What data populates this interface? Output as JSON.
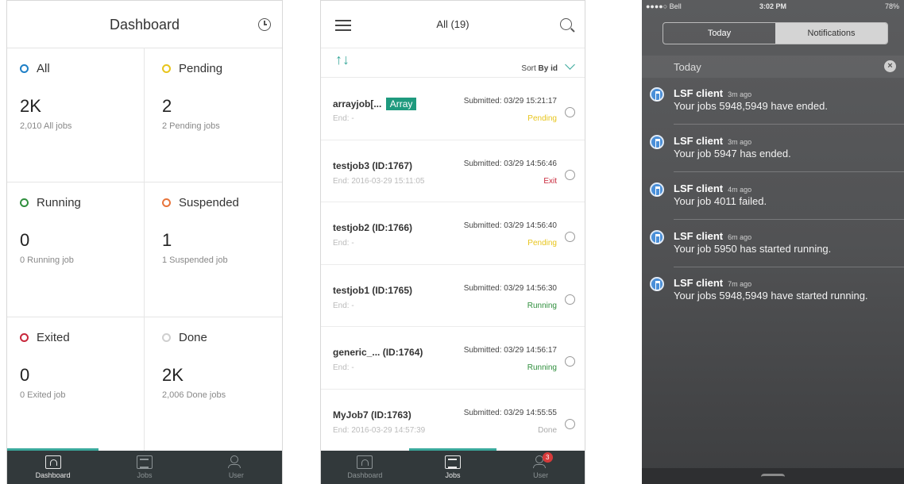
{
  "dashboard": {
    "title": "Dashboard",
    "cells": [
      {
        "label": "All",
        "big": "2K",
        "sub": "2,010 All jobs",
        "color": "#1e7fc6"
      },
      {
        "label": "Pending",
        "big": "2",
        "sub": "2 Pending jobs",
        "color": "#e8c51c"
      },
      {
        "label": "Running",
        "big": "0",
        "sub": "0 Running job",
        "color": "#2f8f3d"
      },
      {
        "label": "Suspended",
        "big": "1",
        "sub": "1 Suspended job",
        "color": "#e8743b"
      },
      {
        "label": "Exited",
        "big": "0",
        "sub": "0 Exited job",
        "color": "#c8283b"
      },
      {
        "label": "Done",
        "big": "2K",
        "sub": "2,006 Done jobs",
        "color": "#cfcfcf"
      }
    ],
    "tabs": [
      {
        "label": "Dashboard",
        "icon": "dashboard-icon"
      },
      {
        "label": "Jobs",
        "icon": "jobs-icon"
      },
      {
        "label": "User",
        "icon": "user-icon"
      }
    ]
  },
  "jobs": {
    "title": "All (19)",
    "sort_prefix": "Sort",
    "sort_key": "By id",
    "rows": [
      {
        "name": "arrayjob[...",
        "tag": "Array",
        "end": "End: -",
        "submitted": "Submitted: 03/29 15:21:17",
        "status": "Pending"
      },
      {
        "name": "testjob3 (ID:1767)",
        "tag": "",
        "end": "End: 2016-03-29 15:11:05",
        "submitted": "Submitted: 03/29 14:56:46",
        "status": "Exit"
      },
      {
        "name": "testjob2 (ID:1766)",
        "tag": "",
        "end": "End: -",
        "submitted": "Submitted: 03/29 14:56:40",
        "status": "Pending"
      },
      {
        "name": "testjob1 (ID:1765)",
        "tag": "",
        "end": "End: -",
        "submitted": "Submitted: 03/29 14:56:30",
        "status": "Running"
      },
      {
        "name": "generic_... (ID:1764)",
        "tag": "",
        "end": "End: -",
        "submitted": "Submitted: 03/29 14:56:17",
        "status": "Running"
      },
      {
        "name": "MyJob7 (ID:1763)",
        "tag": "",
        "end": "End: 2016-03-29 14:57:39",
        "submitted": "Submitted: 03/29 14:55:55",
        "status": "Done"
      }
    ],
    "status_colors": {
      "Pending": "#e8c51c",
      "Exit": "#c8283b",
      "Running": "#2f8f3d",
      "Done": "#aaaaaa"
    },
    "user_badge": "3"
  },
  "notifications": {
    "status_left": "●●●●○ Bell",
    "time": "3:02 PM",
    "battery": "78%",
    "seg_today": "Today",
    "seg_notifications": "Notifications",
    "section": "Today",
    "items": [
      {
        "app": "LSF client",
        "ago": "3m ago",
        "msg": "Your jobs 5948,5949 have ended."
      },
      {
        "app": "LSF client",
        "ago": "3m ago",
        "msg": "Your job 5947 has ended."
      },
      {
        "app": "LSF client",
        "ago": "4m ago",
        "msg": "Your job 4011 failed."
      },
      {
        "app": "LSF client",
        "ago": "6m ago",
        "msg": "Your job 5950 has started running."
      },
      {
        "app": "LSF client",
        "ago": "7m ago",
        "msg": "Your jobs 5948,5949 have started running."
      }
    ]
  }
}
